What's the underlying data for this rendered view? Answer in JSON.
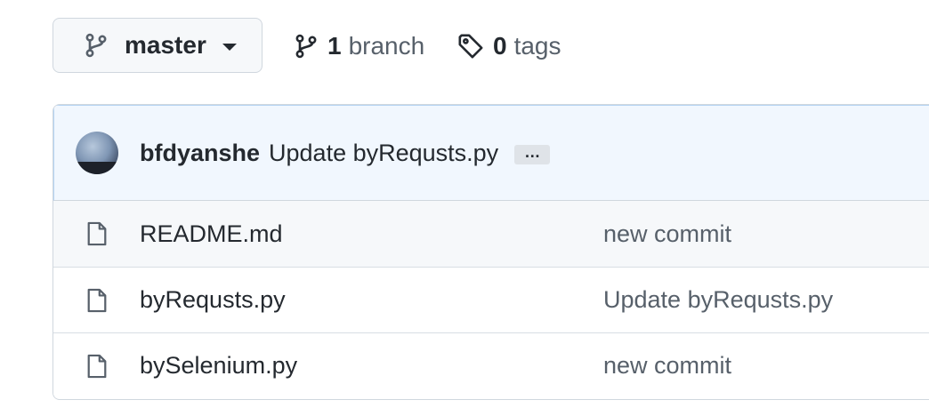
{
  "branch_selector": {
    "current_branch": "master"
  },
  "branches": {
    "count": "1",
    "label": "branch"
  },
  "tags": {
    "count": "0",
    "label": "tags"
  },
  "latest_commit": {
    "author": "bfdyanshe",
    "message": "Update byRequsts.py",
    "ellipsis": "…"
  },
  "files": [
    {
      "name": "README.md",
      "commit_message": "new commit",
      "icon": "file-icon"
    },
    {
      "name": "byRequsts.py",
      "commit_message": "Update byRequsts.py",
      "icon": "file-icon"
    },
    {
      "name": "bySelenium.py",
      "commit_message": "new commit",
      "icon": "file-icon"
    }
  ],
  "colors": {
    "header_bg": "#f1f7fe",
    "border": "#d0d7de",
    "muted_text": "#57606a"
  }
}
